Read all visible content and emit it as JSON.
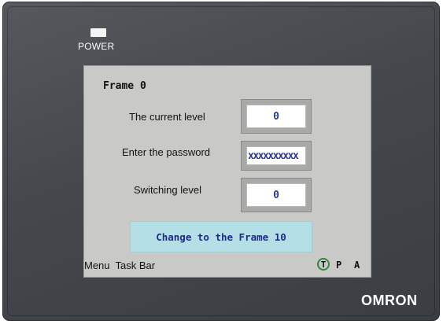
{
  "device": {
    "power_label": "POWER",
    "brand": "OMRON"
  },
  "screen": {
    "frame_title": "Frame 0",
    "current_level": {
      "label": "The current level",
      "value": "0"
    },
    "password": {
      "label": "Enter the password",
      "value": "xxxxxxxxxx"
    },
    "switching_level": {
      "label": "Switching level",
      "value": "0"
    },
    "change_button": "Change to the Frame 10",
    "taskbar": {
      "menu_label": "Menu  Task Bar",
      "t": "T",
      "p": "P",
      "a": "A"
    }
  },
  "colors": {
    "bezel": "#474b4f",
    "screen_bg": "#c9cac8",
    "button_bg": "#b5dfe6",
    "value_text": "#2a3a9a",
    "t_indicator": "#2c8a3a"
  }
}
